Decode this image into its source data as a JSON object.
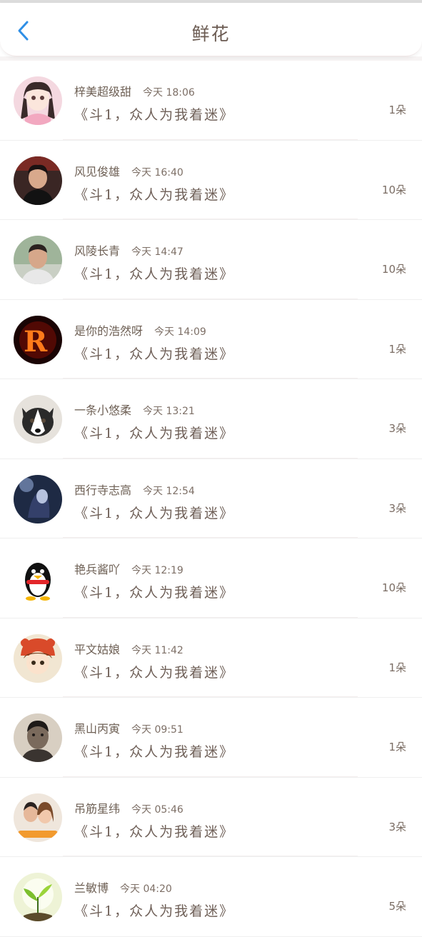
{
  "header": {
    "title": "鲜花"
  },
  "records": [
    {
      "name": "梓美超级甜",
      "time": "今天 18:06",
      "book": "《斗1，众人为我着迷》",
      "count": "1朵",
      "avatar": "anime-girl"
    },
    {
      "name": "风见俊雄",
      "time": "今天 16:40",
      "book": "《斗1，众人为我着迷》",
      "count": "10朵",
      "avatar": "young-man"
    },
    {
      "name": "风陵长青",
      "time": "今天 14:47",
      "book": "《斗1，众人为我着迷》",
      "count": "10朵",
      "avatar": "man-outdoor"
    },
    {
      "name": "是你的浩然呀",
      "time": "今天 14:09",
      "book": "《斗1，众人为我着迷》",
      "count": "1朵",
      "avatar": "fire-letter-r"
    },
    {
      "name": "一条小悠柔",
      "time": "今天 13:21",
      "book": "《斗1，众人为我着迷》",
      "count": "3朵",
      "avatar": "husky-dog"
    },
    {
      "name": "西行寺志高",
      "time": "今天 12:54",
      "book": "《斗1，众人为我着迷》",
      "count": "3朵",
      "avatar": "dark-figure"
    },
    {
      "name": "艳兵酱吖",
      "time": "今天 12:19",
      "book": "《斗1，众人为我着迷》",
      "count": "10朵",
      "avatar": "penguin"
    },
    {
      "name": "平文姑娘",
      "time": "今天 11:42",
      "book": "《斗1，众人为我着迷》",
      "count": "1朵",
      "avatar": "cartoon-tiger-hat"
    },
    {
      "name": "黑山丙寅",
      "time": "今天 09:51",
      "book": "《斗1，众人为我着迷》",
      "count": "1朵",
      "avatar": "man-portrait"
    },
    {
      "name": "吊筋星纬",
      "time": "今天 05:46",
      "book": "《斗1，众人为我着迷》",
      "count": "3朵",
      "avatar": "couple"
    },
    {
      "name": "兰敏博",
      "time": "今天 04:20",
      "book": "《斗1，众人为我着迷》",
      "count": "5朵",
      "avatar": "plant-sprout"
    }
  ],
  "colors": {
    "back_arrow": "#2f8fe6",
    "text": "#6e6055"
  }
}
